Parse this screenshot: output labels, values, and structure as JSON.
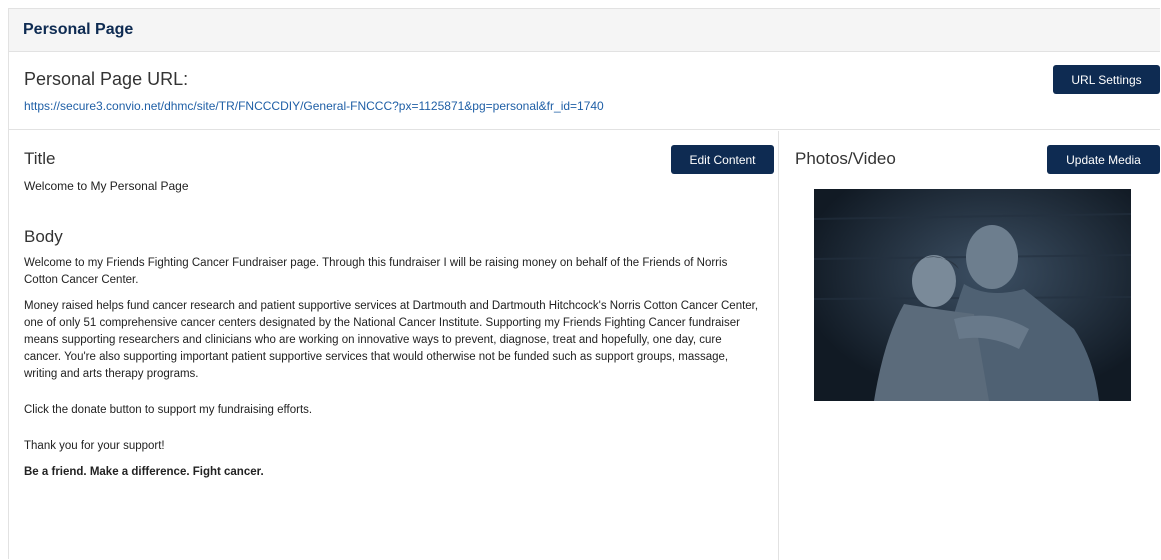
{
  "panel": {
    "title": "Personal Page"
  },
  "url_section": {
    "label": "Personal Page URL:",
    "url": "https://secure3.convio.net/dhmc/site/TR/FNCCCDIY/General-FNCCC?px=1125871&pg=personal&fr_id=1740",
    "settings_button": "URL Settings"
  },
  "content": {
    "title_label": "Title",
    "title_value": "Welcome to My Personal Page",
    "edit_button": "Edit Content",
    "body_label": "Body",
    "paragraphs": [
      "Welcome to my Friends Fighting Cancer Fundraiser page. Through this fundraiser I will be raising money on behalf of the Friends of Norris Cotton Cancer Center.",
      "Money raised helps  fund cancer research and patient supportive services at Dartmouth and Dartmouth Hitchcock's Norris Cotton Cancer Center, one of only 51 comprehensive cancer centers designated by the National Cancer Institute. Supporting my Friends Fighting Cancer fundraiser means supporting researchers and clinicians who are working on innovative ways to prevent, diagnose, treat and hopefully, one day, cure cancer. You're also supporting important patient supportive services that would otherwise not be funded such as support groups, massage, writing and arts therapy programs.",
      "Click the donate button to support my fundraising efforts.",
      "Thank you for your support!",
      "Be a friend. Make a difference. Fight cancer."
    ]
  },
  "media": {
    "label": "Photos/Video",
    "update_button": "Update Media"
  },
  "colors": {
    "accent": "#0e2b52",
    "link": "#1f5fa6",
    "header_bg": "#f5f5f5"
  }
}
